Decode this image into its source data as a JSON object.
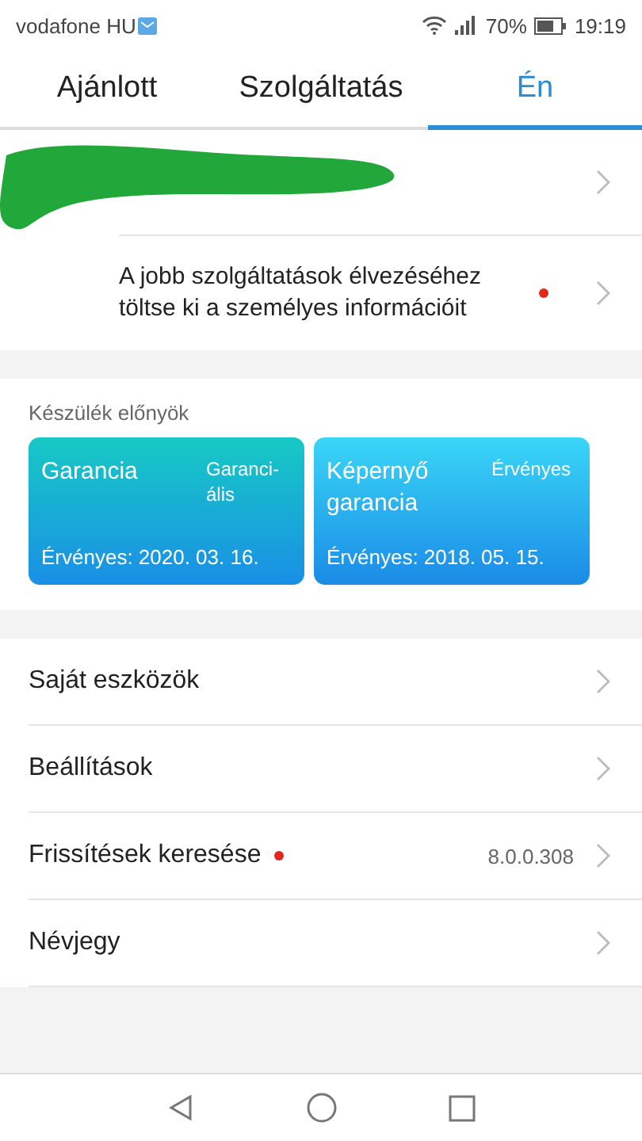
{
  "status_bar": {
    "carrier": "vodafone HU",
    "battery": "70%",
    "time": "19:19"
  },
  "tabs": [
    {
      "label": "Ajánlott",
      "selected": false
    },
    {
      "label": "Szolgáltatás",
      "selected": false
    },
    {
      "label": "Én",
      "selected": true
    }
  ],
  "profile": {
    "notice": "A jobb szolgáltatások élvezéséhez töltse ki a személyes információit",
    "notice_dot": true
  },
  "benefits": {
    "title": "Készülék előnyök",
    "cards": [
      {
        "title": "Garancia",
        "tag": "Garanci-ális",
        "validity": "Érvényes: 2020. 03. 16."
      },
      {
        "title": "Képernyő garancia",
        "tag": "Érvényes",
        "validity": "Érvényes: 2018. 05. 15."
      }
    ]
  },
  "menu": [
    {
      "label": "Saját eszközök",
      "dot": false
    },
    {
      "label": "Beállítások",
      "dot": false
    },
    {
      "label": "Frissítések keresése",
      "dot": true,
      "value": "8.0.0.308"
    },
    {
      "label": "Névjegy",
      "dot": false
    }
  ]
}
